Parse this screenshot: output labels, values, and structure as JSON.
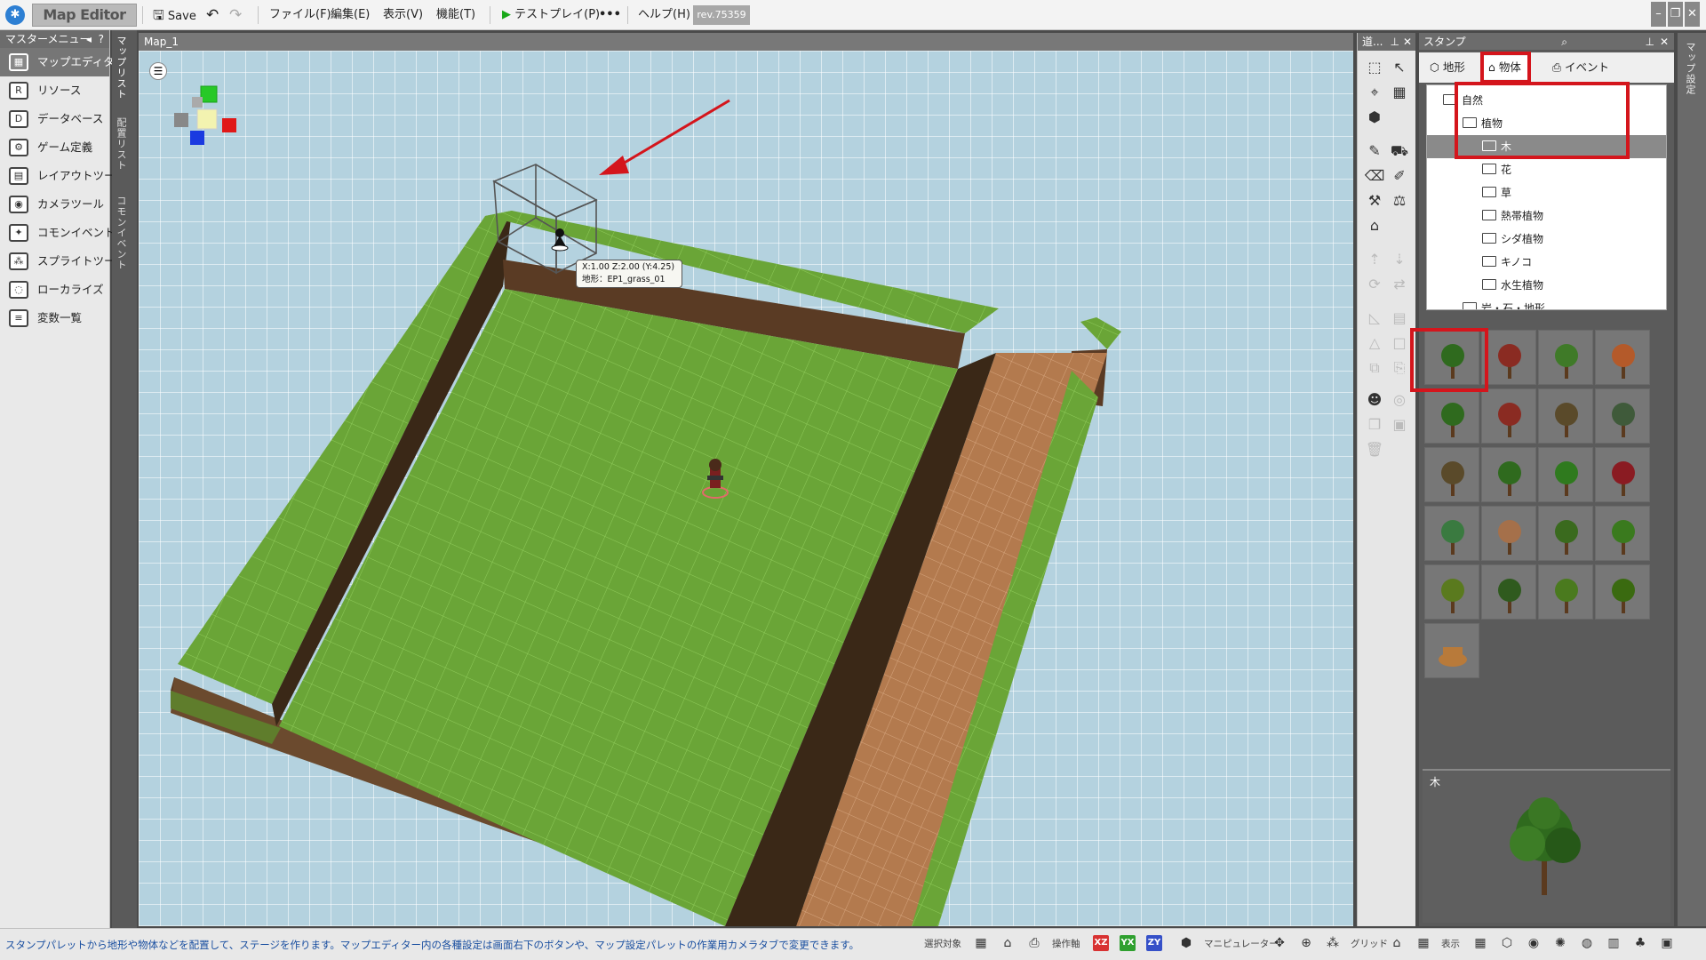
{
  "window": {
    "app_title": "Map Editor",
    "save": "Save",
    "menu": [
      "ファイル(F)",
      "編集(E)",
      "表示(V)",
      "機能(T)"
    ],
    "test_play": "テストプレイ(P)",
    "more": "•••",
    "help": "ヘルプ(H)",
    "revision": "rev.75359"
  },
  "master_menu": {
    "title": "マスターメニュー",
    "items": [
      {
        "label": "マップエディター",
        "icon": "map-editor-icon",
        "active": true
      },
      {
        "label": "リソース",
        "icon": "resource-icon"
      },
      {
        "label": "データベース",
        "icon": "database-icon"
      },
      {
        "label": "ゲーム定義",
        "icon": "game-definition-icon"
      },
      {
        "label": "レイアウトツール",
        "icon": "layout-tool-icon"
      },
      {
        "label": "カメラツール",
        "icon": "camera-tool-icon"
      },
      {
        "label": "コモンイベント",
        "icon": "common-event-icon"
      },
      {
        "label": "スプライトツール",
        "icon": "sprite-tool-icon"
      },
      {
        "label": "ローカライズ",
        "icon": "localize-icon"
      },
      {
        "label": "変数一覧",
        "icon": "variable-list-icon"
      }
    ]
  },
  "side_tabs": [
    "マップリスト",
    "配置リスト",
    "コモンイベント"
  ],
  "viewport": {
    "title": "Map_1",
    "tooltip_line1": "X:1.00 Z:2.00 (Y:4.25)",
    "tooltip_line2": "地形：EP1_grass_01"
  },
  "tools": {
    "title": "道..."
  },
  "stamp": {
    "title": "スタンプ",
    "tabs": [
      {
        "label": "地形"
      },
      {
        "label": "物体",
        "active": true
      },
      {
        "label": "イベント"
      }
    ],
    "tree": [
      {
        "label": "自然",
        "level": 0,
        "open": true
      },
      {
        "label": "植物",
        "level": 1,
        "open": true
      },
      {
        "label": "木",
        "level": 2,
        "selected": true
      },
      {
        "label": "花",
        "level": 2
      },
      {
        "label": "草",
        "level": 2
      },
      {
        "label": "熱帯植物",
        "level": 2
      },
      {
        "label": "シダ植物",
        "level": 2
      },
      {
        "label": "キノコ",
        "level": 2
      },
      {
        "label": "水生植物",
        "level": 2
      },
      {
        "label": "岩・石・地形",
        "level": 1
      }
    ],
    "preview_label": "木"
  },
  "status": {
    "message": "スタンプパレットから地形や物体などを配置して、ステージを作ります。マップエディター内の各種設定は画面右下のボタンや、マップ設定パレットの作業用カメラタブで変更できます。",
    "select_target": "選択対象",
    "operation_axis": "操作軸",
    "axis_xz": "XZ",
    "axis_yx": "YX",
    "axis_zy": "ZY",
    "manipulator": "マニピュレーター",
    "grid": "グリッド",
    "display": "表示"
  },
  "right_strip": "マップ設定",
  "colors": {
    "highlight": "#d4151c",
    "grass": "#6aa537",
    "dirt": "#6b4a2e",
    "path": "#b37a4e"
  }
}
